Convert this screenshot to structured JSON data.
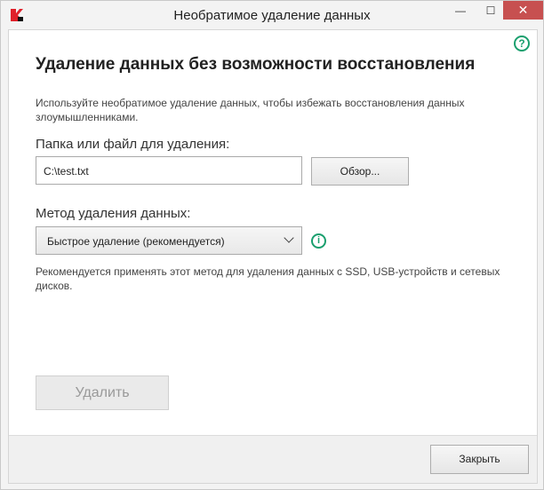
{
  "window": {
    "title": "Необратимое удаление данных",
    "minimize": "—",
    "maximize": "☐",
    "close": "✕"
  },
  "help_icon": "?",
  "heading": "Удаление данных без возможности восстановления",
  "description": "Используйте необратимое удаление данных, чтобы избежать восстановления данных злоумышленниками.",
  "path": {
    "label": "Папка или файл для удаления:",
    "value": "C:\\test.txt",
    "browse_label": "Обзор..."
  },
  "method": {
    "label": "Метод удаления данных:",
    "selected": "Быстрое удаление (рекомендуется)",
    "info_icon": "i",
    "note": "Рекомендуется применять этот метод для удаления данных с SSD, USB-устройств и сетевых дисков."
  },
  "delete_label": "Удалить",
  "close_label": "Закрыть"
}
